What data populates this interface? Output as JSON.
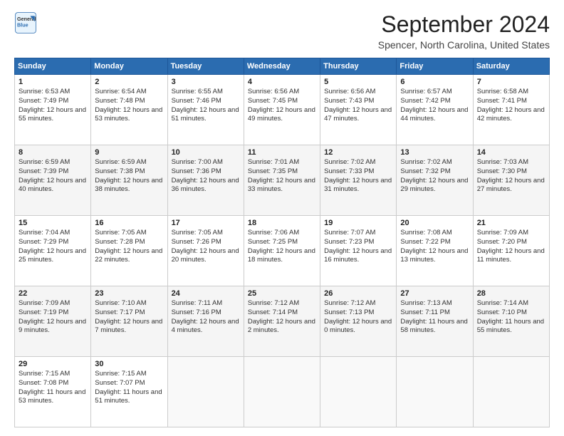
{
  "logo": {
    "line1": "General",
    "line2": "Blue"
  },
  "title": "September 2024",
  "subtitle": "Spencer, North Carolina, United States",
  "weekdays": [
    "Sunday",
    "Monday",
    "Tuesday",
    "Wednesday",
    "Thursday",
    "Friday",
    "Saturday"
  ],
  "weeks": [
    [
      {
        "day": "1",
        "sunrise": "6:53 AM",
        "sunset": "7:49 PM",
        "daylight": "12 hours and 55 minutes."
      },
      {
        "day": "2",
        "sunrise": "6:54 AM",
        "sunset": "7:48 PM",
        "daylight": "12 hours and 53 minutes."
      },
      {
        "day": "3",
        "sunrise": "6:55 AM",
        "sunset": "7:46 PM",
        "daylight": "12 hours and 51 minutes."
      },
      {
        "day": "4",
        "sunrise": "6:56 AM",
        "sunset": "7:45 PM",
        "daylight": "12 hours and 49 minutes."
      },
      {
        "day": "5",
        "sunrise": "6:56 AM",
        "sunset": "7:43 PM",
        "daylight": "12 hours and 47 minutes."
      },
      {
        "day": "6",
        "sunrise": "6:57 AM",
        "sunset": "7:42 PM",
        "daylight": "12 hours and 44 minutes."
      },
      {
        "day": "7",
        "sunrise": "6:58 AM",
        "sunset": "7:41 PM",
        "daylight": "12 hours and 42 minutes."
      }
    ],
    [
      {
        "day": "8",
        "sunrise": "6:59 AM",
        "sunset": "7:39 PM",
        "daylight": "12 hours and 40 minutes."
      },
      {
        "day": "9",
        "sunrise": "6:59 AM",
        "sunset": "7:38 PM",
        "daylight": "12 hours and 38 minutes."
      },
      {
        "day": "10",
        "sunrise": "7:00 AM",
        "sunset": "7:36 PM",
        "daylight": "12 hours and 36 minutes."
      },
      {
        "day": "11",
        "sunrise": "7:01 AM",
        "sunset": "7:35 PM",
        "daylight": "12 hours and 33 minutes."
      },
      {
        "day": "12",
        "sunrise": "7:02 AM",
        "sunset": "7:33 PM",
        "daylight": "12 hours and 31 minutes."
      },
      {
        "day": "13",
        "sunrise": "7:02 AM",
        "sunset": "7:32 PM",
        "daylight": "12 hours and 29 minutes."
      },
      {
        "day": "14",
        "sunrise": "7:03 AM",
        "sunset": "7:30 PM",
        "daylight": "12 hours and 27 minutes."
      }
    ],
    [
      {
        "day": "15",
        "sunrise": "7:04 AM",
        "sunset": "7:29 PM",
        "daylight": "12 hours and 25 minutes."
      },
      {
        "day": "16",
        "sunrise": "7:05 AM",
        "sunset": "7:28 PM",
        "daylight": "12 hours and 22 minutes."
      },
      {
        "day": "17",
        "sunrise": "7:05 AM",
        "sunset": "7:26 PM",
        "daylight": "12 hours and 20 minutes."
      },
      {
        "day": "18",
        "sunrise": "7:06 AM",
        "sunset": "7:25 PM",
        "daylight": "12 hours and 18 minutes."
      },
      {
        "day": "19",
        "sunrise": "7:07 AM",
        "sunset": "7:23 PM",
        "daylight": "12 hours and 16 minutes."
      },
      {
        "day": "20",
        "sunrise": "7:08 AM",
        "sunset": "7:22 PM",
        "daylight": "12 hours and 13 minutes."
      },
      {
        "day": "21",
        "sunrise": "7:09 AM",
        "sunset": "7:20 PM",
        "daylight": "12 hours and 11 minutes."
      }
    ],
    [
      {
        "day": "22",
        "sunrise": "7:09 AM",
        "sunset": "7:19 PM",
        "daylight": "12 hours and 9 minutes."
      },
      {
        "day": "23",
        "sunrise": "7:10 AM",
        "sunset": "7:17 PM",
        "daylight": "12 hours and 7 minutes."
      },
      {
        "day": "24",
        "sunrise": "7:11 AM",
        "sunset": "7:16 PM",
        "daylight": "12 hours and 4 minutes."
      },
      {
        "day": "25",
        "sunrise": "7:12 AM",
        "sunset": "7:14 PM",
        "daylight": "12 hours and 2 minutes."
      },
      {
        "day": "26",
        "sunrise": "7:12 AM",
        "sunset": "7:13 PM",
        "daylight": "12 hours and 0 minutes."
      },
      {
        "day": "27",
        "sunrise": "7:13 AM",
        "sunset": "7:11 PM",
        "daylight": "11 hours and 58 minutes."
      },
      {
        "day": "28",
        "sunrise": "7:14 AM",
        "sunset": "7:10 PM",
        "daylight": "11 hours and 55 minutes."
      }
    ],
    [
      {
        "day": "29",
        "sunrise": "7:15 AM",
        "sunset": "7:08 PM",
        "daylight": "11 hours and 53 minutes."
      },
      {
        "day": "30",
        "sunrise": "7:15 AM",
        "sunset": "7:07 PM",
        "daylight": "11 hours and 51 minutes."
      },
      null,
      null,
      null,
      null,
      null
    ]
  ]
}
